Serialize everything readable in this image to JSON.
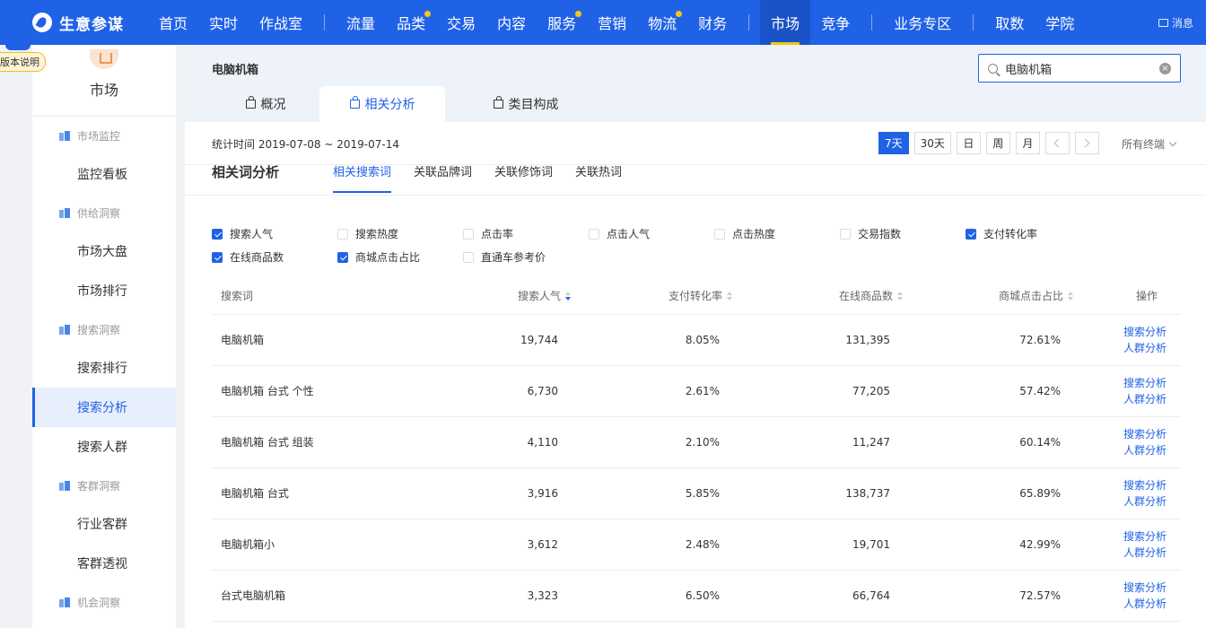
{
  "topnav": {
    "brand": "生意参谋",
    "groups": [
      [
        {
          "label": "首页"
        },
        {
          "label": "实时"
        },
        {
          "label": "作战室"
        }
      ],
      [
        {
          "label": "流量"
        },
        {
          "label": "品类",
          "dot": true
        },
        {
          "label": "交易"
        },
        {
          "label": "内容"
        },
        {
          "label": "服务",
          "dot": true
        },
        {
          "label": "营销"
        },
        {
          "label": "物流",
          "dot": true
        },
        {
          "label": "财务"
        }
      ],
      [
        {
          "label": "市场",
          "active": true
        },
        {
          "label": "竞争"
        }
      ],
      [
        {
          "label": "业务专区"
        }
      ],
      [
        {
          "label": "取数"
        },
        {
          "label": "学院"
        }
      ]
    ],
    "message": "消息"
  },
  "version_tag": "版本说明",
  "sidebar": {
    "title": "市场",
    "groups": [
      {
        "label": "市场监控",
        "items": [
          {
            "label": "监控看板"
          }
        ]
      },
      {
        "label": "供给洞察",
        "items": [
          {
            "label": "市场大盘"
          },
          {
            "label": "市场排行"
          }
        ]
      },
      {
        "label": "搜索洞察",
        "items": [
          {
            "label": "搜索排行"
          },
          {
            "label": "搜索分析",
            "active": true
          },
          {
            "label": "搜索人群"
          }
        ]
      },
      {
        "label": "客群洞察",
        "items": [
          {
            "label": "行业客群"
          },
          {
            "label": "客群透视"
          }
        ]
      },
      {
        "label": "机会洞察",
        "items": []
      }
    ]
  },
  "header": {
    "title": "电脑机箱",
    "search_value": "电脑机箱",
    "tabs": [
      {
        "label": "概况"
      },
      {
        "label": "相关分析",
        "active": true
      },
      {
        "label": "类目构成"
      }
    ]
  },
  "stats": {
    "date_range": "统计时间 2019-07-08 ~ 2019-07-14",
    "date_buttons": [
      {
        "label": "7天",
        "active": true
      },
      {
        "label": "30天"
      },
      {
        "label": "日"
      },
      {
        "label": "周"
      },
      {
        "label": "月"
      }
    ],
    "terminal": "所有终端"
  },
  "analysis": {
    "title": "相关词分析",
    "tabs": [
      {
        "label": "相关搜索词",
        "active": true
      },
      {
        "label": "关联品牌词"
      },
      {
        "label": "关联修饰词"
      },
      {
        "label": "关联热词"
      }
    ]
  },
  "metrics": [
    {
      "label": "搜索人气",
      "checked": true
    },
    {
      "label": "搜索热度",
      "checked": false
    },
    {
      "label": "点击率",
      "checked": false
    },
    {
      "label": "点击人气",
      "checked": false
    },
    {
      "label": "点击热度",
      "checked": false
    },
    {
      "label": "交易指数",
      "checked": false
    },
    {
      "label": "支付转化率",
      "checked": true
    },
    {
      "label": "在线商品数",
      "checked": true
    },
    {
      "label": "商城点击占比",
      "checked": true
    },
    {
      "label": "直通车参考价",
      "checked": false
    }
  ],
  "table": {
    "columns": [
      "搜索词",
      "搜索人气",
      "支付转化率",
      "在线商品数",
      "商城点击占比",
      "操作"
    ],
    "actions": [
      "搜索分析",
      "人群分析"
    ],
    "rows": [
      [
        "电脑机箱",
        "19,744",
        "8.05%",
        "131,395",
        "72.61%"
      ],
      [
        "电脑机箱 台式 个性",
        "6,730",
        "2.61%",
        "77,205",
        "57.42%"
      ],
      [
        "电脑机箱 台式 组装",
        "4,110",
        "2.10%",
        "11,247",
        "60.14%"
      ],
      [
        "电脑机箱 台式",
        "3,916",
        "5.85%",
        "138,737",
        "65.89%"
      ],
      [
        "电脑机箱小",
        "3,612",
        "2.48%",
        "19,701",
        "42.99%"
      ],
      [
        "台式电脑机箱",
        "3,323",
        "6.50%",
        "66,764",
        "72.57%"
      ]
    ]
  },
  "colors": {
    "primary": "#2062e6",
    "nav_dot": "#f5c518"
  }
}
